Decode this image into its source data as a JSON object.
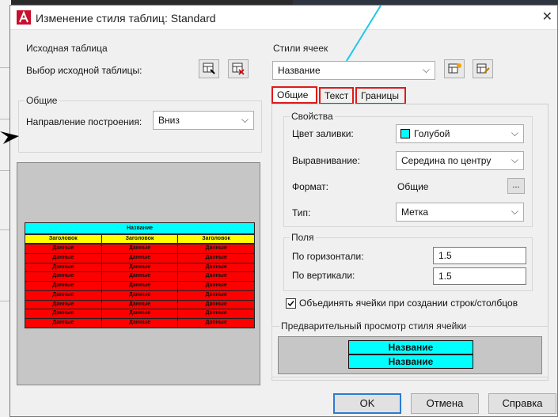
{
  "dialog": {
    "title": "Изменение стиля таблиц: Standard"
  },
  "source_table": {
    "group_title": "Исходная таблица",
    "select_label": "Выбор исходной таблицы:"
  },
  "general": {
    "group_title": "Общие",
    "direction_label": "Направление построения:",
    "direction_value": "Вниз"
  },
  "preview_table": {
    "title": "Название",
    "header": [
      "Заголовок",
      "Заголовок",
      "Заголовок"
    ],
    "cell": "Данные",
    "row_count": 9,
    "colors": {
      "title": "#00ffff",
      "header": "#ffff00",
      "data": "#ff0000"
    }
  },
  "cell_styles": {
    "group_title": "Стили ячеек",
    "style_value": "Название"
  },
  "tabs": [
    "Общие",
    "Текст",
    "Границы"
  ],
  "properties": {
    "group_title": "Свойства",
    "fill_label": "Цвет заливки:",
    "fill_value": "Голубой",
    "fill_color": "#00ffff",
    "align_label": "Выравнивание:",
    "align_value": "Середина по центру",
    "format_label": "Формат:",
    "format_value": "Общие",
    "format_button": "...",
    "type_label": "Тип:",
    "type_value": "Метка"
  },
  "margins": {
    "group_title": "Поля",
    "horizontal_label": "По горизонтали:",
    "horizontal_value": "1.5",
    "vertical_label": "По вертикали:",
    "vertical_value": "1.5"
  },
  "merge": {
    "label": "Объединять ячейки при создании строк/столбцов",
    "checked": true
  },
  "cell_preview": {
    "group_title": "Предварительный просмотр стиля ячейки",
    "line1": "Название",
    "line2": "Название"
  },
  "buttons": {
    "ok": "OK",
    "cancel": "Отмена",
    "help": "Справка"
  }
}
